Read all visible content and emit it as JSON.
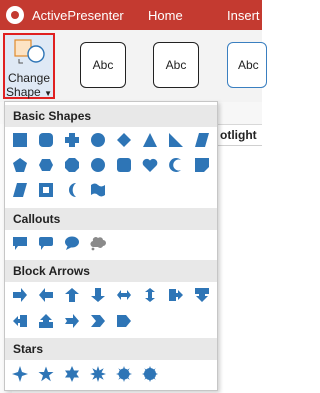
{
  "titlebar": {
    "app_name": "ActivePresenter",
    "menu": [
      "Home",
      "Insert"
    ]
  },
  "ribbon": {
    "change_shape": {
      "line1": "Change",
      "line2": "Shape"
    },
    "styles": [
      "Abc",
      "Abc",
      "Abc"
    ]
  },
  "background": {
    "partial_text": "otlight"
  },
  "dropdown": {
    "sections": [
      {
        "title": "Basic Shapes",
        "shapes": [
          "rectangle",
          "rounded-rectangle",
          "plus",
          "circle",
          "diamond",
          "triangle",
          "right-triangle",
          "parallelogram",
          "pentagon",
          "hexagon",
          "octagon",
          "oval",
          "rounded-rect-alt",
          "heart",
          "crescent",
          "folded-corner",
          "parallelogram-alt",
          "frame",
          "moon",
          "wave"
        ]
      },
      {
        "title": "Callouts",
        "shapes": [
          "rect-callout",
          "rounded-rect-callout",
          "oval-callout",
          "cloud-callout"
        ]
      },
      {
        "title": "Block Arrows",
        "shapes": [
          "right-arrow",
          "left-arrow",
          "up-arrow",
          "down-arrow",
          "left-right-arrow",
          "up-down-arrow",
          "right-arrow-callout",
          "down-arrow-callout",
          "left-arrow-callout",
          "up-arrow-callout",
          "notched-up-arrow",
          "chevron",
          "pentagon-arrow"
        ]
      },
      {
        "title": "Stars",
        "shapes": [
          "4-point-star",
          "5-point-star",
          "6-point-star",
          "8-point-star",
          "12-point-star",
          "16-point-star"
        ]
      }
    ]
  },
  "colors": {
    "shape_fill": "#2e75b6",
    "title_bar": "#c43a30",
    "highlight": "#e02020"
  }
}
